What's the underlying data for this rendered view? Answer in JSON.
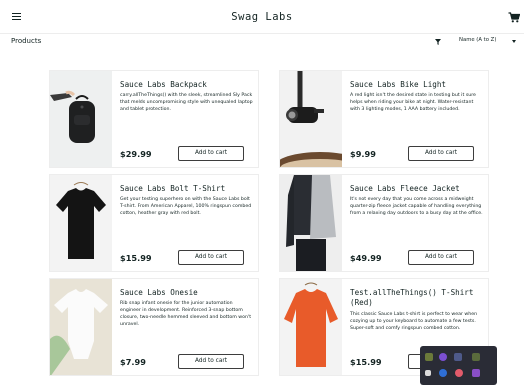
{
  "header": {
    "title": "Swag Labs",
    "menu_icon": "hamburger-menu-icon",
    "cart_icon": "shopping-cart-icon"
  },
  "subheader": {
    "title": "Products",
    "sort_icon": "sort-filter-icon",
    "sort_value": "Name (A to Z)"
  },
  "products": [
    {
      "name": "Sauce Labs Backpack",
      "description": "carry.allTheThings() with the sleek, streamlined Sly Pack that melds uncompromising style with unequaled laptop and tablet protection.",
      "price": "$29.99",
      "button": "Add to cart"
    },
    {
      "name": "Sauce Labs Bike Light",
      "description": "A red light isn't the desired state in testing but it sure helps when riding your bike at night. Water-resistant with 3 lighting modes, 1 AAA battery included.",
      "price": "$9.99",
      "button": "Add to cart"
    },
    {
      "name": "Sauce Labs Bolt T-Shirt",
      "description": "Get your testing superhero on with the Sauce Labs bolt T-shirt. From American Apparel, 100% ringspun combed cotton, heather gray with red bolt.",
      "price": "$15.99",
      "button": "Add to cart"
    },
    {
      "name": "Sauce Labs Fleece Jacket",
      "description": "It's not every day that you come across a midweight quarter-zip fleece jacket capable of handling everything from a relaxing day outdoors to a busy day at the office.",
      "price": "$49.99",
      "button": "Add to cart"
    },
    {
      "name": "Sauce Labs Onesie",
      "description": "Rib snap infant onesie for the junior automation engineer in development. Reinforced 3-snap bottom closure, two-needle hemmed sleeved and bottom won't unravel.",
      "price": "$7.99",
      "button": "Add to cart"
    },
    {
      "name": "Test.allTheThings() T-Shirt (Red)",
      "description": "This classic Sauce Labs t-shirt is perfect to wear when cozying up to your keyboard to automate a few tests. Super-soft and comfy ringspun combed cotton.",
      "price": "$15.99",
      "button": "Add to cart"
    }
  ],
  "colors": {
    "text": "#132322",
    "border": "#ededed",
    "button_border": "#3d3d3d",
    "tray_background": "#2a2c36"
  }
}
